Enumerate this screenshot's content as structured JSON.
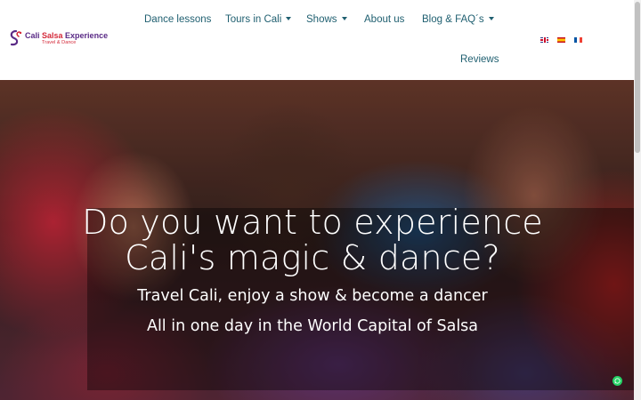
{
  "logo": {
    "title_part1": "Cali ",
    "title_part2": "Salsa",
    "title_part3": " Experience",
    "subtitle": "Travel & Dance"
  },
  "nav": {
    "items": [
      {
        "label": "Dance lessons",
        "has_dropdown": false
      },
      {
        "label": "Tours in Cali",
        "has_dropdown": true
      },
      {
        "label": "Shows",
        "has_dropdown": true
      },
      {
        "label": "About us",
        "has_dropdown": false
      },
      {
        "label": "Blog & FAQ´s",
        "has_dropdown": true
      },
      {
        "label": "Reviews",
        "has_dropdown": false
      }
    ],
    "dropdown_icon": "chevron-down-icon"
  },
  "languages": [
    {
      "code": "en",
      "icon": "uk-flag-icon"
    },
    {
      "code": "es",
      "icon": "spain-flag-icon"
    },
    {
      "code": "fr",
      "icon": "france-flag-icon"
    }
  ],
  "hero": {
    "headline_line1": "Do you want to experience",
    "headline_line2": "Cali's magic & dance?",
    "subheadline": "Travel Cali, enjoy a show & become a dancer",
    "subheadline2": "All in one day in the World Capital of Salsa"
  },
  "colors": {
    "nav_text": "#1f5f70",
    "logo_purple": "#5a2a86",
    "logo_red": "#d42a3a",
    "whatsapp_green": "#25d366"
  },
  "widgets": {
    "chat_icon": "whatsapp-icon"
  }
}
